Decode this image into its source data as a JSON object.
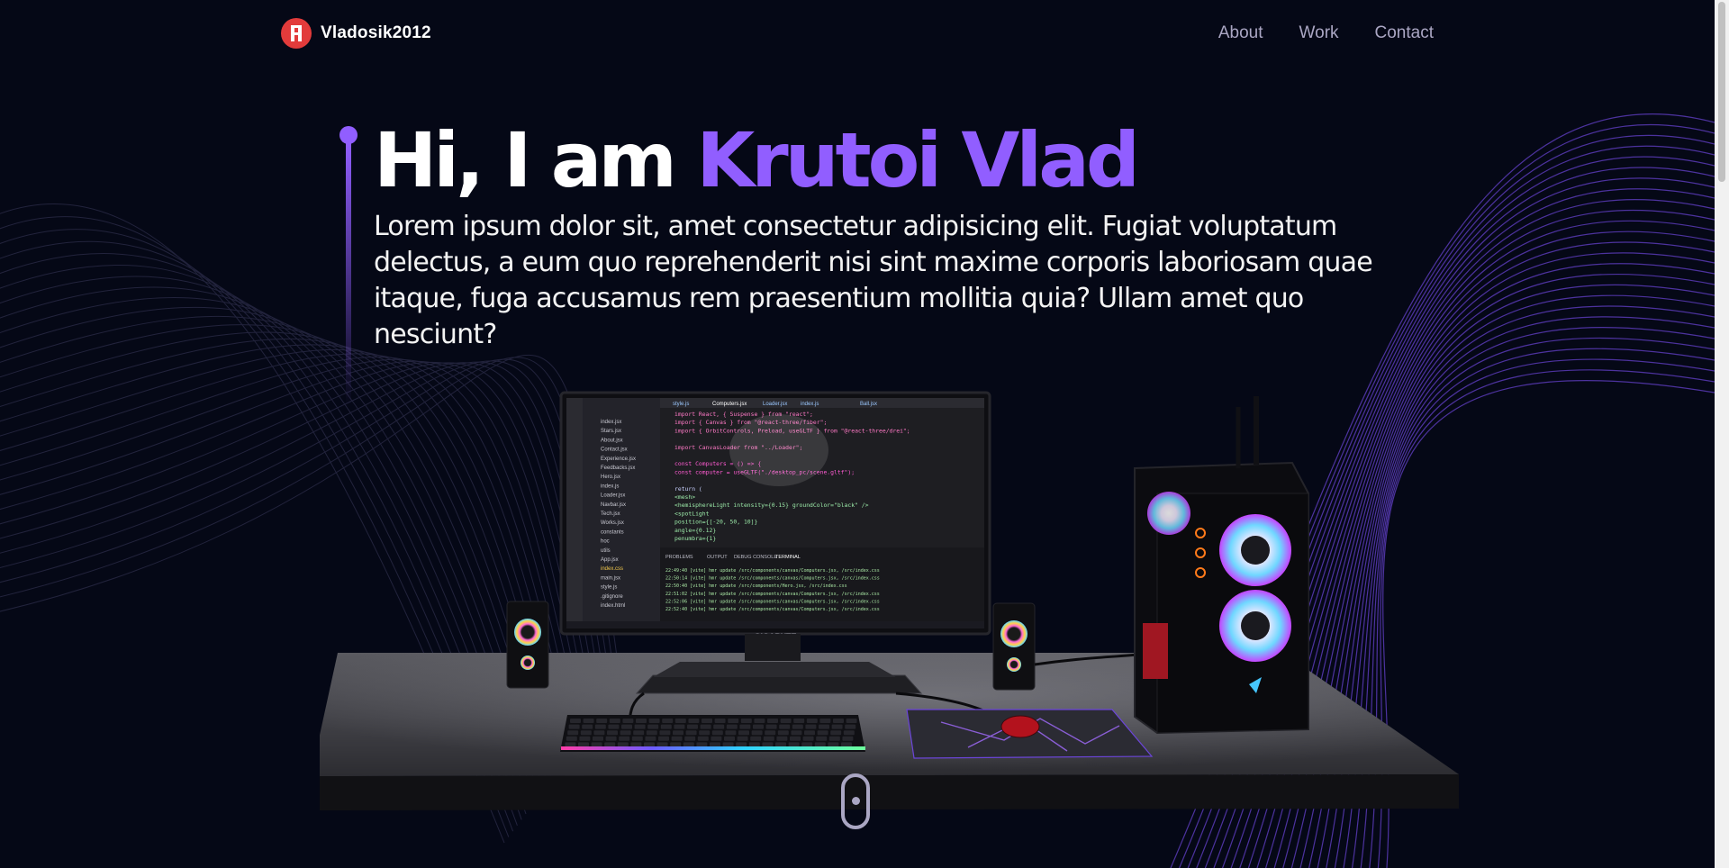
{
  "navbar": {
    "brand": "Vladosik2012",
    "links": [
      {
        "label": "About"
      },
      {
        "label": "Work"
      },
      {
        "label": "Contact"
      }
    ]
  },
  "hero": {
    "title_prefix": "Hi, I am ",
    "title_name": "Krutoi Vlad",
    "subtitle": "Lorem ipsum dolor sit, amet consectetur adipisicing elit. Fugiat voluptatum delectus, a eum quo reprehenderit nisi sint maxime corporis laboriosam quae itaque, fuga accusamus rem praesentium mollitia quia? Ullam amet quo nesciunt?"
  },
  "scene": {
    "monitor_brand": "GIGABYTE",
    "code_lines": [
      "import React, { Suspense } from \"react\";",
      "import { Canvas } from \"@react-three/fiber\";",
      "import { OrbitControls, Preload, useGLTF } from \"@react-three/drei\";",
      "",
      "import CanvasLoader from \"../Loader\";",
      "",
      "const Computers = () => {",
      "  const computer = useGLTF(\"./desktop_pc/scene.gltf\");",
      "",
      "  return (",
      "    <mesh>",
      "      <hemisphereLight intensity={0.15} groundColor=\"black\" />",
      "      <spotLight",
      "        position={[-20, 50, 10]}",
      "        angle={0.12}",
      "        penumbra={1}"
    ],
    "files": [
      "index.jsx",
      "Stars.jsx",
      "About.jsx",
      "Contact.jsx",
      "Experience.jsx",
      "Feedbacks.jsx",
      "Hero.jsx",
      "index.js",
      "Loader.jsx",
      "Navbar.jsx",
      "Tech.jsx",
      "Works.jsx",
      "constants",
      "hoc",
      "utils",
      "App.jsx",
      "index.css",
      "main.jsx",
      "style.js",
      ".gitignore",
      "index.html"
    ],
    "terminal_lines": [
      "22:49:40 [vite] hmr update /src/components/canvas/Computers.jsx, /src/index.css",
      "22:50:14 [vite] hmr update /src/components/canvas/Computers.jsx, /src/index.css",
      "22:50:40 [vite] hmr update /src/components/Hero.jsx, /src/index.css",
      "22:51:02 [vite] hmr update /src/components/canvas/Computers.jsx, /src/index.css",
      "22:52:06 [vite] hmr update /src/components/canvas/Computers.jsx, /src/index.css",
      "22:52:40 [vite] hmr update /src/components/canvas/Computers.jsx, /src/index.css"
    ]
  },
  "colors": {
    "background": "#050816",
    "accent": "#915eff",
    "nav_text": "#aaa6c3",
    "logo_badge": "#e23b3b"
  },
  "icons": {
    "logo": "logo-badge-icon",
    "scroll": "mouse-scroll-icon"
  }
}
